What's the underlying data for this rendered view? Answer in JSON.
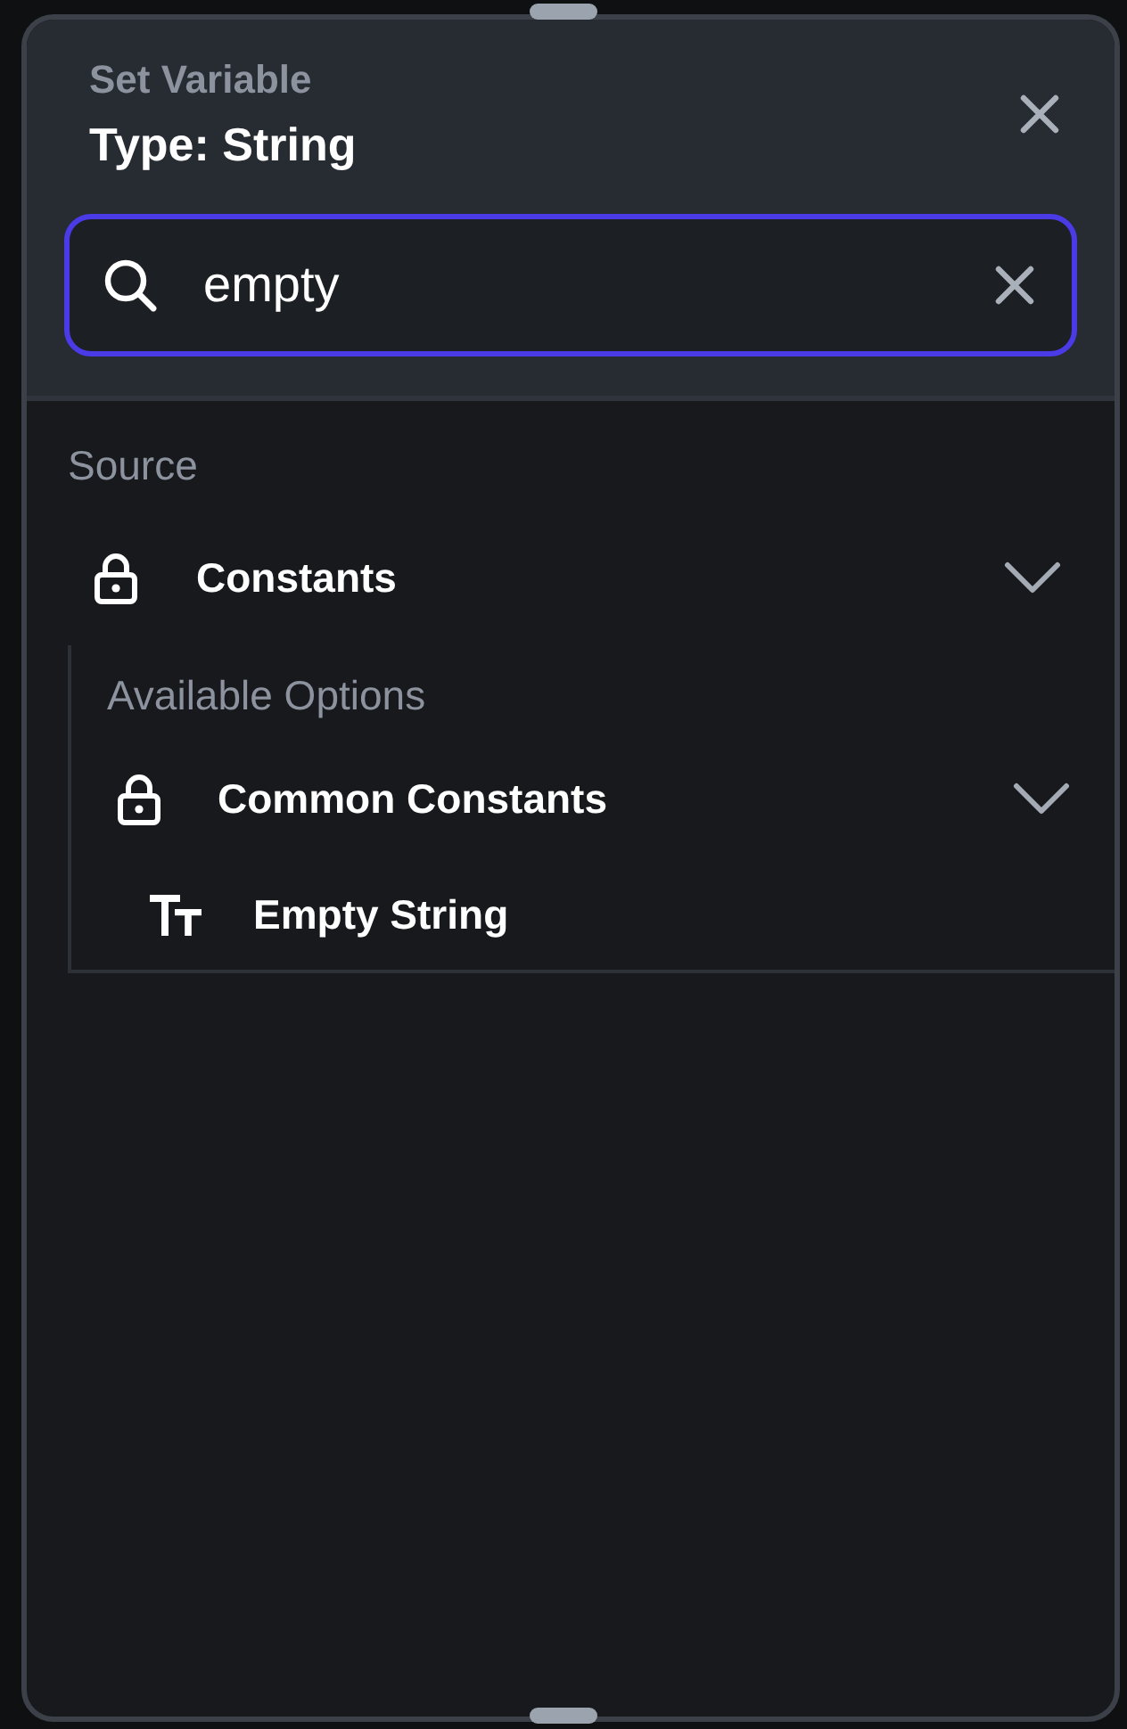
{
  "header": {
    "subtitle": "Set Variable",
    "title": "Type: String"
  },
  "search": {
    "value": "empty",
    "focused": true
  },
  "source": {
    "label": "Source",
    "items": [
      {
        "label": "Constants",
        "kind": "group",
        "expanded": true,
        "options_label": "Available Options",
        "children": [
          {
            "label": "Common Constants",
            "kind": "group",
            "expanded": true,
            "children": [
              {
                "label": "Empty String",
                "kind": "string"
              }
            ]
          }
        ]
      }
    ]
  }
}
